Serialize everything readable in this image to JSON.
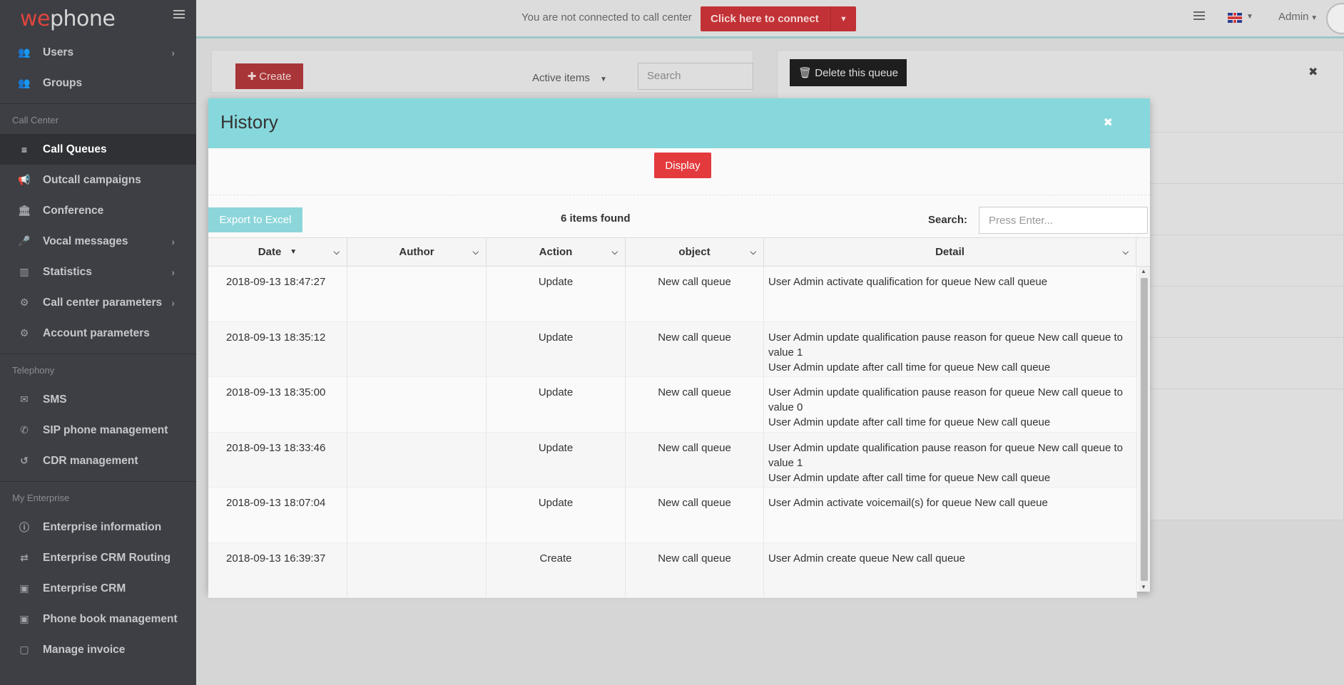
{
  "app": {
    "logo_we": "we",
    "logo_phone": "phone"
  },
  "sidebar": {
    "top_items": [
      {
        "label": "Users",
        "icon": "users-icon",
        "has_chevron": true
      },
      {
        "label": "Groups",
        "icon": "users-icon",
        "has_chevron": false
      }
    ],
    "sections": [
      {
        "label": "Call Center",
        "items": [
          {
            "label": "Call Queues",
            "icon": "list-icon",
            "active": true
          },
          {
            "label": "Outcall campaigns",
            "icon": "megaphone-icon"
          },
          {
            "label": "Conference",
            "icon": "bank-icon"
          },
          {
            "label": "Vocal messages",
            "icon": "microphone-icon",
            "has_chevron": true
          },
          {
            "label": "Statistics",
            "icon": "bar-chart-icon",
            "has_chevron": true
          },
          {
            "label": "Call center parameters",
            "icon": "cogs-icon",
            "has_chevron": true
          },
          {
            "label": "Account parameters",
            "icon": "gear-icon"
          }
        ]
      },
      {
        "label": "Telephony",
        "items": [
          {
            "label": "SMS",
            "icon": "envelope-icon"
          },
          {
            "label": "SIP phone management",
            "icon": "phone-icon"
          },
          {
            "label": "CDR management",
            "icon": "history-icon"
          }
        ]
      },
      {
        "label": "My Enterprise",
        "items": [
          {
            "label": "Enterprise information",
            "icon": "info-icon"
          },
          {
            "label": "Enterprise CRM Routing",
            "icon": "exchange-icon"
          },
          {
            "label": "Enterprise CRM",
            "icon": "crm-icon"
          },
          {
            "label": "Phone book management",
            "icon": "crm-icon"
          },
          {
            "label": "Manage invoice",
            "icon": "invoice-icon"
          }
        ]
      }
    ]
  },
  "topbar": {
    "status_text": "You are not connected to call center",
    "connect_label": "Click here to connect",
    "admin_label": "Admin"
  },
  "background": {
    "create_label": "Create",
    "filter_label": "Active items",
    "search_placeholder": "Search",
    "delete_label": "Delete this queue"
  },
  "modal": {
    "title": "History",
    "display_label": "Display",
    "export_label": "Export to Excel",
    "items_found": "6 items found",
    "search_label": "Search:",
    "search_placeholder": "Press Enter...",
    "columns": [
      "Date",
      "Author",
      "Action",
      "object",
      "Detail"
    ],
    "rows": [
      {
        "date": "2018-09-13 18:47:27",
        "author": "",
        "action": "Update",
        "object": "New call queue",
        "detail": [
          "User Admin activate qualification for queue New call queue"
        ]
      },
      {
        "date": "2018-09-13 18:35:12",
        "author": "",
        "action": "Update",
        "object": "New call queue",
        "detail": [
          "User Admin update qualification pause reason for queue New call queue to value 1",
          "User Admin update after call time for queue New call queue"
        ]
      },
      {
        "date": "2018-09-13 18:35:00",
        "author": "",
        "action": "Update",
        "object": "New call queue",
        "detail": [
          "User Admin update qualification pause reason for queue New call queue to value 0",
          "User Admin update after call time for queue New call queue"
        ]
      },
      {
        "date": "2018-09-13 18:33:46",
        "author": "",
        "action": "Update",
        "object": "New call queue",
        "detail": [
          "User Admin update qualification pause reason for queue New call queue to value 1",
          "User Admin update after call time for queue New call queue"
        ]
      },
      {
        "date": "2018-09-13 18:07:04",
        "author": "",
        "action": "Update",
        "object": "New call queue",
        "detail": [
          "User Admin activate voicemail(s) for queue New call queue"
        ]
      },
      {
        "date": "2018-09-13 16:39:37",
        "author": "",
        "action": "Create",
        "object": "New call queue",
        "detail": [
          "User Admin create queue New call queue"
        ]
      }
    ]
  },
  "colors": {
    "brand_red": "#e33a3d",
    "header_teal": "#87d8dc",
    "sidebar_bg": "#3d3f44"
  }
}
